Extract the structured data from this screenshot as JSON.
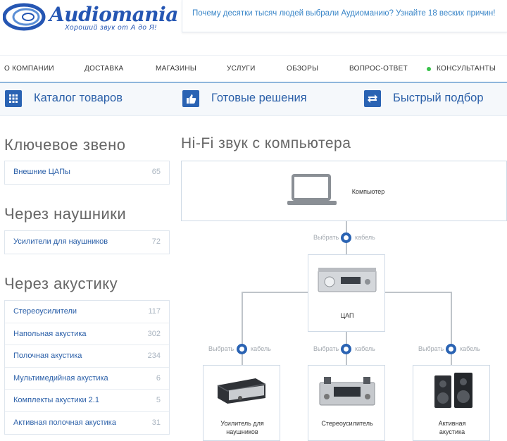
{
  "header": {
    "logo_title": "Audiomania",
    "logo_tagline": "Хороший звук от А до Я!",
    "promo": "Почему десятки тысяч людей выбрали Аудиоманию? Узнайте 18 веских причин!"
  },
  "topnav": [
    "О КОМПАНИИ",
    "ДОСТАВКА",
    "МАГАЗИНЫ",
    "УСЛУГИ",
    "ОБЗОРЫ",
    "ВОПРОС-ОТВЕТ",
    "КОНСУЛЬТАНТЫ"
  ],
  "topnav_status_color": "#39c24a",
  "menubar": [
    {
      "label": "Каталог товаров",
      "icon": "grid-icon"
    },
    {
      "label": "Готовые решения",
      "icon": "thumbs-up-icon"
    },
    {
      "label": "Быстрый подбор",
      "icon": "swap-arrows-icon"
    }
  ],
  "sidebar": {
    "sections": [
      {
        "title": "Ключевое звено",
        "items": [
          {
            "name": "Внешние ЦАПы",
            "count": "65"
          }
        ]
      },
      {
        "title": "Через наушники",
        "items": [
          {
            "name": "Усилители для наушников",
            "count": "72"
          }
        ]
      },
      {
        "title": "Через акустику",
        "items": [
          {
            "name": "Стереоусилители",
            "count": "117"
          },
          {
            "name": "Напольная акустика",
            "count": "302"
          },
          {
            "name": "Полочная акустика",
            "count": "234"
          },
          {
            "name": "Мультимедийная акустика",
            "count": "6"
          },
          {
            "name": "Комплекты акустики 2.1",
            "count": "5"
          },
          {
            "name": "Активная полочная акустика",
            "count": "31"
          }
        ]
      }
    ]
  },
  "diagram": {
    "title": "Hi-Fi звук с компьютера",
    "computer": "Компьютер",
    "dac": "ЦАП",
    "choose": "Выбрать",
    "cable": "кабель",
    "outputs": [
      "Усилитель для наушников",
      "Стереоусилитель",
      "Активная акустика"
    ]
  },
  "colors": {
    "accent": "#2a63b3",
    "link": "#2a5fa8",
    "count": "#a9b4c0"
  }
}
